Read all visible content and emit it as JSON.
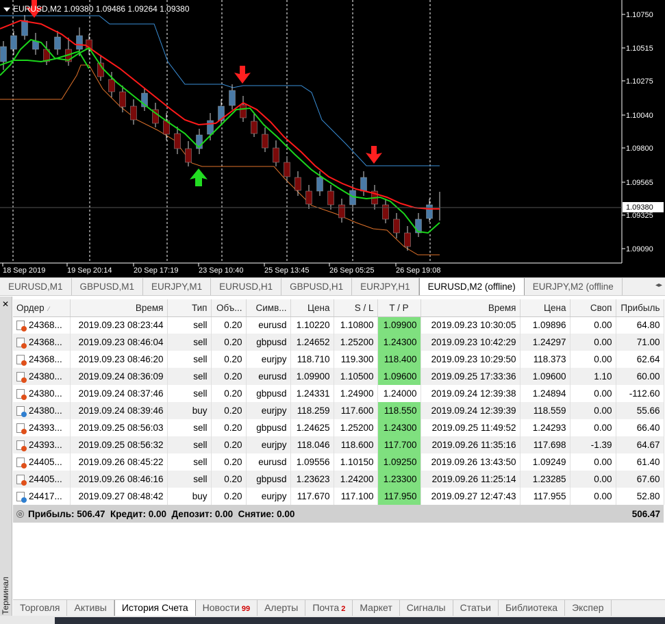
{
  "chart": {
    "title": "EURUSD,M2  1.09380 1.09486 1.09264 1.09380",
    "price_labels": [
      "1.10750",
      "1.10515",
      "1.10275",
      "1.10040",
      "1.09800",
      "1.09565",
      "1.09325",
      "1.09090"
    ],
    "current_price": "1.09380",
    "time_labels": [
      "18 Sep 2019",
      "19 Sep 20:14",
      "20 Sep 17:19",
      "23 Sep 10:40",
      "25 Sep 13:45",
      "26 Sep 05:25",
      "26 Sep 19:08"
    ],
    "colors": {
      "background": "#000000",
      "bull": "#4a7aa6",
      "bear": "#7a0a0a",
      "ma_fast": "#ff1a1a",
      "ma_green": "#1bd61b",
      "channel_top": "#3a8fd8",
      "channel_bottom": "#e0722a",
      "arrow_down": "#ff2020",
      "arrow_up": "#22dd22"
    }
  },
  "chart_tabs": [
    {
      "label": "EURUSD,M1",
      "active": false
    },
    {
      "label": "GBPUSD,M1",
      "active": false
    },
    {
      "label": "EURJPY,M1",
      "active": false
    },
    {
      "label": "EURUSD,H1",
      "active": false
    },
    {
      "label": "GBPUSD,H1",
      "active": false
    },
    {
      "label": "EURJPY,H1",
      "active": false
    },
    {
      "label": "EURUSD,M2 (offline)",
      "active": true
    },
    {
      "label": "EURJPY,M2 (offline",
      "active": false
    }
  ],
  "terminal": {
    "label": "Терминал",
    "columns": [
      "Ордер",
      "Время",
      "Тип",
      "Объ...",
      "Симв...",
      "Цена",
      "S / L",
      "T / P",
      "Время",
      "Цена",
      "Своп",
      "Прибыль"
    ],
    "rows": [
      {
        "order": "24368...",
        "open_time": "2019.09.23 08:23:44",
        "type": "sell",
        "volume": "0.20",
        "symbol": "eurusd",
        "open_price": "1.10220",
        "sl": "1.10800",
        "tp": "1.09900",
        "tp_hit": true,
        "close_time": "2019.09.23 10:30:05",
        "close_price": "1.09896",
        "swap": "0.00",
        "profit": "64.80"
      },
      {
        "order": "24368...",
        "open_time": "2019.09.23 08:46:04",
        "type": "sell",
        "volume": "0.20",
        "symbol": "gbpusd",
        "open_price": "1.24652",
        "sl": "1.25200",
        "tp": "1.24300",
        "tp_hit": true,
        "close_time": "2019.09.23 10:42:29",
        "close_price": "1.24297",
        "swap": "0.00",
        "profit": "71.00"
      },
      {
        "order": "24368...",
        "open_time": "2019.09.23 08:46:20",
        "type": "sell",
        "volume": "0.20",
        "symbol": "eurjpy",
        "open_price": "118.710",
        "sl": "119.300",
        "tp": "118.400",
        "tp_hit": true,
        "close_time": "2019.09.23 10:29:50",
        "close_price": "118.373",
        "swap": "0.00",
        "profit": "62.64"
      },
      {
        "order": "24380...",
        "open_time": "2019.09.24 08:36:09",
        "type": "sell",
        "volume": "0.20",
        "symbol": "eurusd",
        "open_price": "1.09900",
        "sl": "1.10500",
        "tp": "1.09600",
        "tp_hit": true,
        "close_time": "2019.09.25 17:33:36",
        "close_price": "1.09600",
        "swap": "1.10",
        "profit": "60.00"
      },
      {
        "order": "24380...",
        "open_time": "2019.09.24 08:37:46",
        "type": "sell",
        "volume": "0.20",
        "symbol": "gbpusd",
        "open_price": "1.24331",
        "sl": "1.24900",
        "tp": "1.24000",
        "tp_hit": false,
        "close_time": "2019.09.24 12:39:38",
        "close_price": "1.24894",
        "swap": "0.00",
        "profit": "-112.60"
      },
      {
        "order": "24380...",
        "open_time": "2019.09.24 08:39:46",
        "type": "buy",
        "volume": "0.20",
        "symbol": "eurjpy",
        "open_price": "118.259",
        "sl": "117.600",
        "tp": "118.550",
        "tp_hit": true,
        "close_time": "2019.09.24 12:39:39",
        "close_price": "118.559",
        "swap": "0.00",
        "profit": "55.66"
      },
      {
        "order": "24393...",
        "open_time": "2019.09.25 08:56:03",
        "type": "sell",
        "volume": "0.20",
        "symbol": "gbpusd",
        "open_price": "1.24625",
        "sl": "1.25200",
        "tp": "1.24300",
        "tp_hit": true,
        "close_time": "2019.09.25 11:49:52",
        "close_price": "1.24293",
        "swap": "0.00",
        "profit": "66.40"
      },
      {
        "order": "24393...",
        "open_time": "2019.09.25 08:56:32",
        "type": "sell",
        "volume": "0.20",
        "symbol": "eurjpy",
        "open_price": "118.046",
        "sl": "118.600",
        "tp": "117.700",
        "tp_hit": true,
        "close_time": "2019.09.26 11:35:16",
        "close_price": "117.698",
        "swap": "-1.39",
        "profit": "64.67"
      },
      {
        "order": "24405...",
        "open_time": "2019.09.26 08:45:22",
        "type": "sell",
        "volume": "0.20",
        "symbol": "eurusd",
        "open_price": "1.09556",
        "sl": "1.10150",
        "tp": "1.09250",
        "tp_hit": true,
        "close_time": "2019.09.26 13:43:50",
        "close_price": "1.09249",
        "swap": "0.00",
        "profit": "61.40"
      },
      {
        "order": "24405...",
        "open_time": "2019.09.26 08:46:16",
        "type": "sell",
        "volume": "0.20",
        "symbol": "gbpusd",
        "open_price": "1.23623",
        "sl": "1.24200",
        "tp": "1.23300",
        "tp_hit": true,
        "close_time": "2019.09.26 11:25:14",
        "close_price": "1.23285",
        "swap": "0.00",
        "profit": "67.60"
      },
      {
        "order": "24417...",
        "open_time": "2019.09.27 08:48:42",
        "type": "buy",
        "volume": "0.20",
        "symbol": "eurjpy",
        "open_price": "117.670",
        "sl": "117.100",
        "tp": "117.950",
        "tp_hit": true,
        "close_time": "2019.09.27 12:47:43",
        "close_price": "117.955",
        "swap": "0.00",
        "profit": "52.80"
      }
    ],
    "summary": {
      "text": "Прибыль: 506.47  Кредит: 0.00  Депозит: 0.00  Снятие: 0.00",
      "total": "506.47"
    }
  },
  "bottom_tabs": [
    {
      "label": "Торговля",
      "badge": "",
      "active": false
    },
    {
      "label": "Активы",
      "badge": "",
      "active": false
    },
    {
      "label": "История Счета",
      "badge": "",
      "active": true
    },
    {
      "label": "Новости",
      "badge": "99",
      "active": false
    },
    {
      "label": "Алерты",
      "badge": "",
      "active": false
    },
    {
      "label": "Почта",
      "badge": "2",
      "active": false
    },
    {
      "label": "Маркет",
      "badge": "",
      "active": false
    },
    {
      "label": "Сигналы",
      "badge": "",
      "active": false
    },
    {
      "label": "Статьи",
      "badge": "",
      "active": false
    },
    {
      "label": "Библиотека",
      "badge": "",
      "active": false
    },
    {
      "label": "Экспер",
      "badge": "",
      "active": false
    }
  ]
}
